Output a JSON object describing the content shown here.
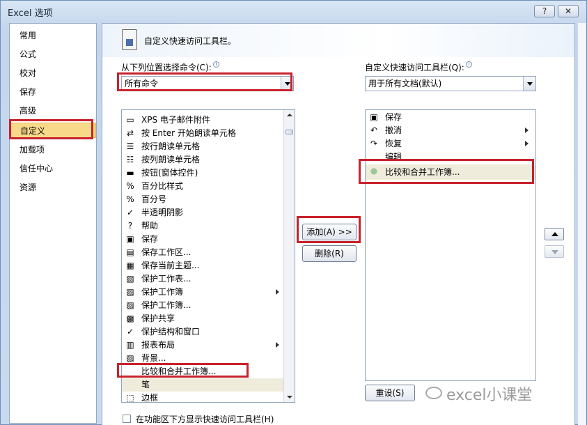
{
  "window": {
    "title": "Excel 选项",
    "help_button": "?",
    "close_button": "✕"
  },
  "sidebar": {
    "items": [
      {
        "label": "常用"
      },
      {
        "label": "公式"
      },
      {
        "label": "校对"
      },
      {
        "label": "保存"
      },
      {
        "label": "高级"
      },
      {
        "label": "自定义",
        "selected": true
      },
      {
        "label": "加载项"
      },
      {
        "label": "信任中心"
      },
      {
        "label": "资源"
      }
    ]
  },
  "main": {
    "banner_title": "自定义快速访问工具栏。",
    "left_label": "从下列位置选择命令(C):",
    "left_combo_value": "所有命令",
    "right_label": "自定义快速访问工具栏(Q):",
    "right_combo_value": "用于所有文档(默认)",
    "commands": [
      {
        "icon": "▭",
        "label": "XPS 电子邮件附件"
      },
      {
        "icon": "⇄",
        "label": "按 Enter 开始朗读单元格"
      },
      {
        "icon": "☰",
        "label": "按行朗读单元格"
      },
      {
        "icon": "☷",
        "label": "按列朗读单元格"
      },
      {
        "icon": "▬",
        "label": "按钮(窗体控件)"
      },
      {
        "icon": "%",
        "label": "百分比样式"
      },
      {
        "icon": "%",
        "label": "百分号"
      },
      {
        "icon": "✓",
        "label": "半透明阴影"
      },
      {
        "icon": "?",
        "label": "帮助"
      },
      {
        "icon": "▣",
        "label": "保存"
      },
      {
        "icon": "▤",
        "label": "保存工作区..."
      },
      {
        "icon": "▦",
        "label": "保存当前主题..."
      },
      {
        "icon": "▧",
        "label": "保护工作表..."
      },
      {
        "icon": "▨",
        "label": "保护工作簿",
        "submenu": true
      },
      {
        "icon": "▨",
        "label": "保护工作簿..."
      },
      {
        "icon": "▩",
        "label": "保护共享"
      },
      {
        "icon": "✓",
        "label": "保护结构和窗口"
      },
      {
        "icon": "▥",
        "label": "报表布局",
        "submenu": true
      },
      {
        "icon": "▨",
        "label": "背景..."
      },
      {
        "icon": "",
        "label": "比较和合并工作簿..."
      },
      {
        "icon": "",
        "label": "笔",
        "highlight": true
      },
      {
        "icon": "⬚",
        "label": "边框"
      }
    ],
    "add_button": "添加(A) >>",
    "remove_button": "删除(R)",
    "toolbar_items": [
      {
        "icon": "▣",
        "label": "保存"
      },
      {
        "icon": "↶",
        "label": "撤消",
        "submenu": true
      },
      {
        "icon": "↷",
        "label": "恢复",
        "submenu": true
      },
      {
        "icon": "",
        "label": "编辑"
      },
      {
        "icon": "●",
        "label": "比较和合并工作簿...",
        "highlight": true
      }
    ],
    "reset_button": "重设(S)",
    "show_below_ribbon": "在功能区下方显示快速访问工具栏(H)"
  },
  "watermark": "excel小课堂",
  "colors": {
    "annotation_red": "#c8222c",
    "selected_sidebar": "#f8d98a"
  }
}
